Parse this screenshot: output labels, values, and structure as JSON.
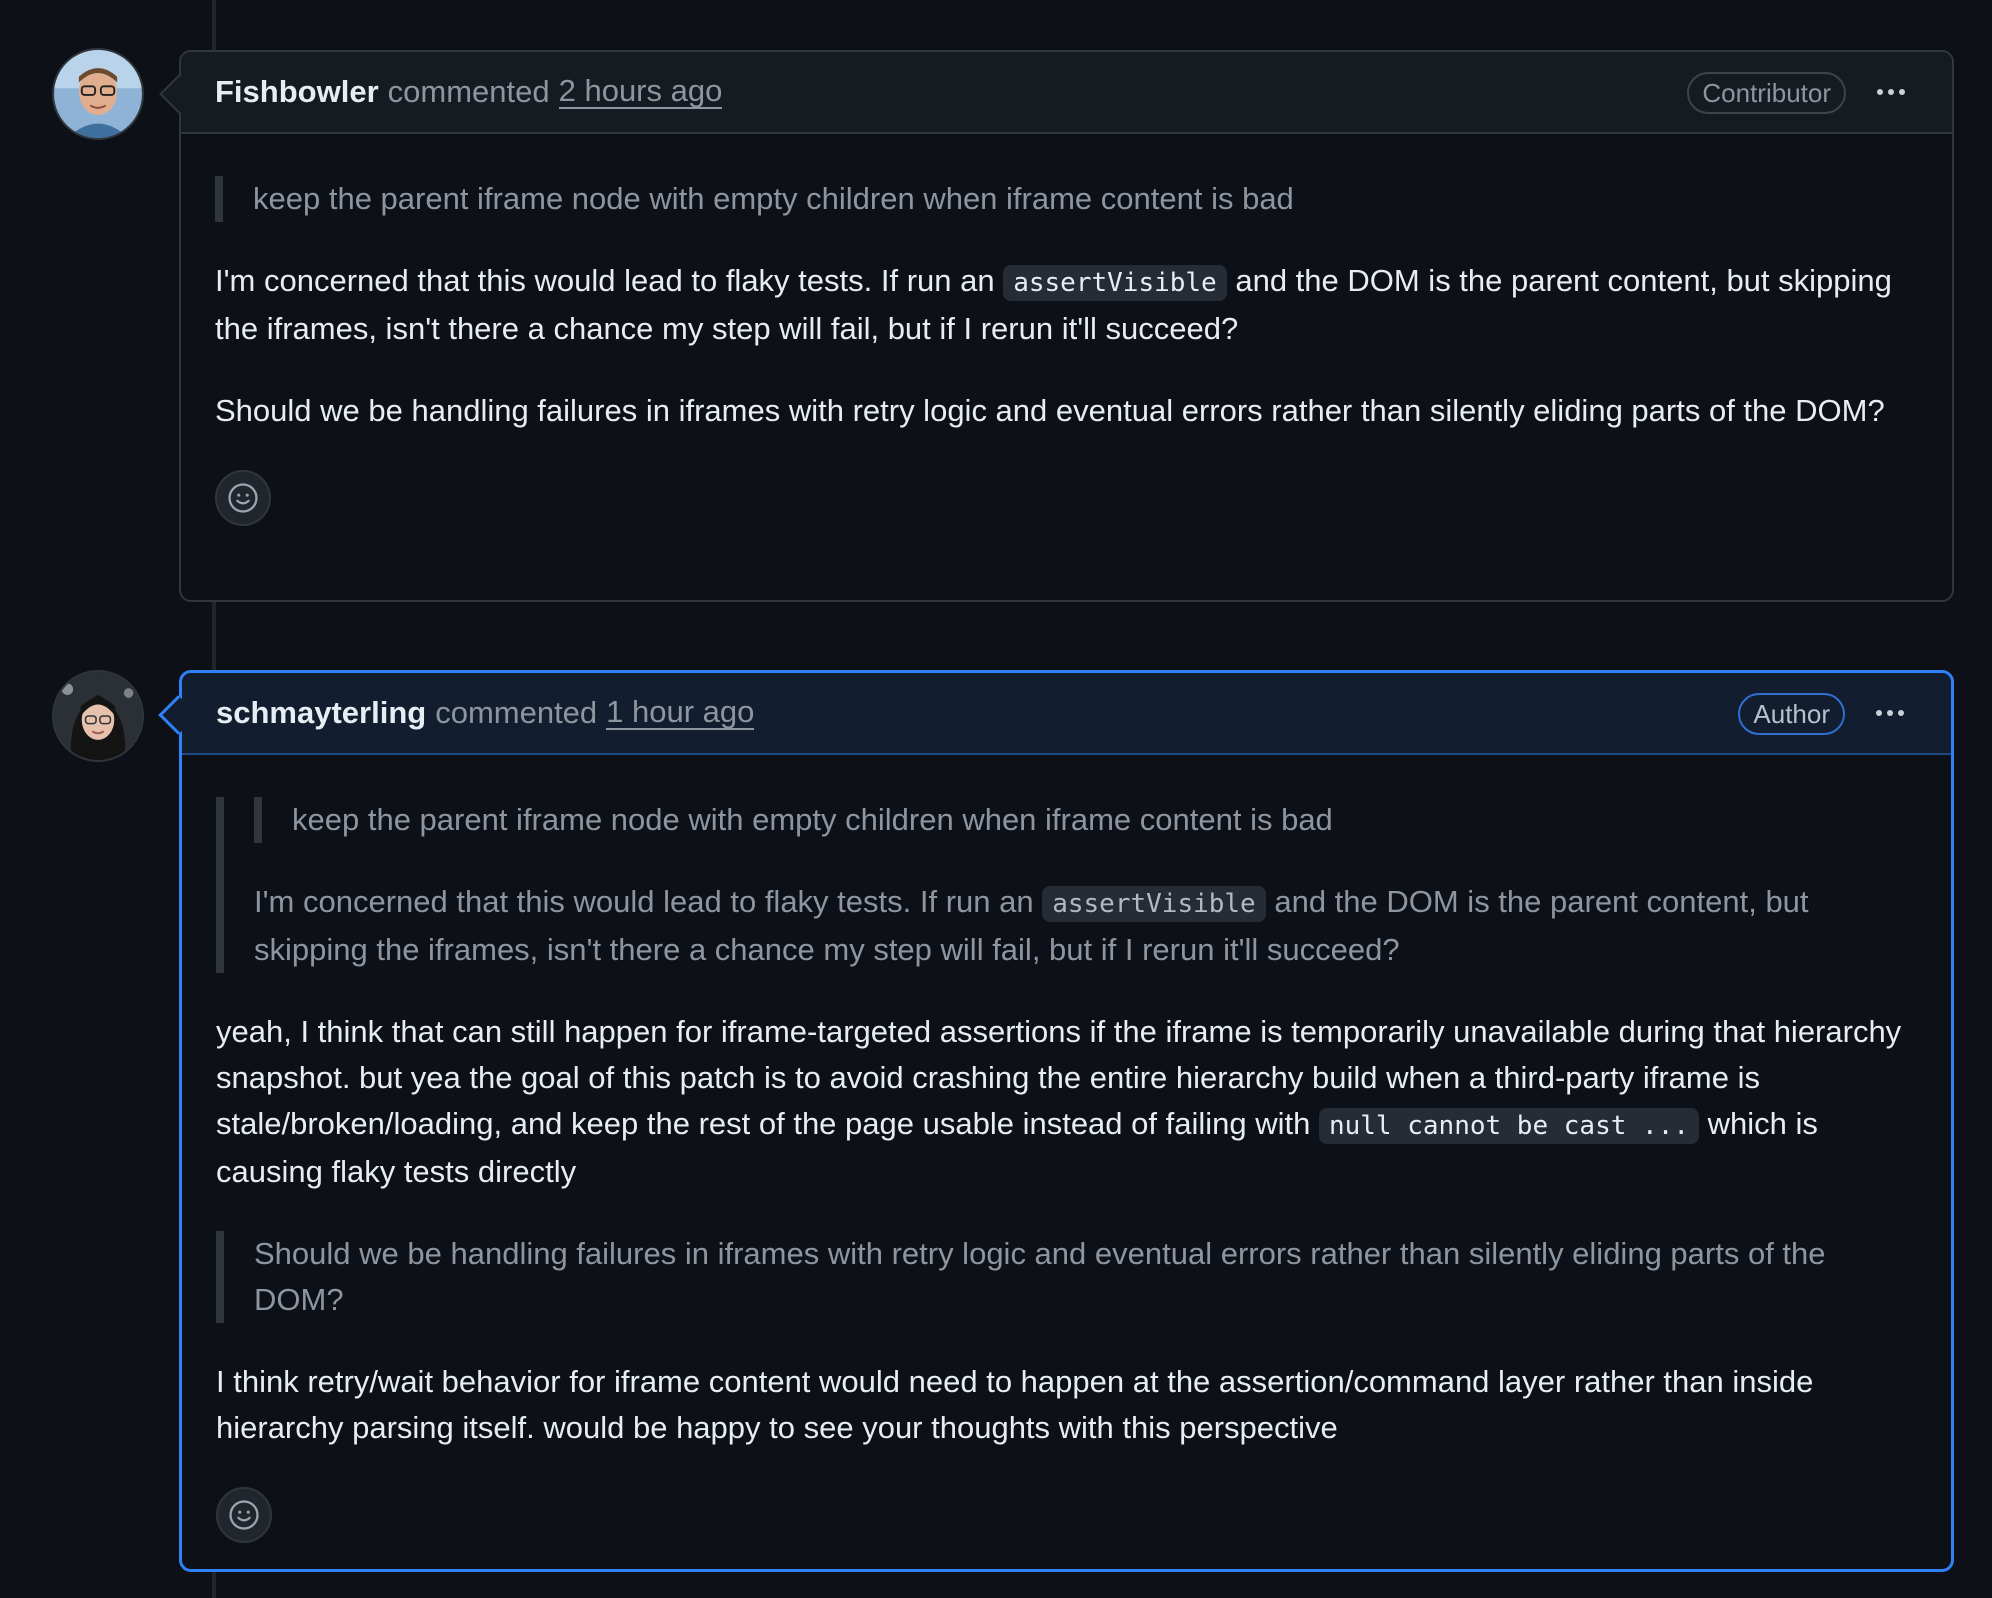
{
  "comments": [
    {
      "username": "Fishbowler",
      "verb": "commented",
      "timestamp": "2 hours ago",
      "role": "Contributor",
      "quote": "keep the parent iframe node with empty children when iframe content is bad",
      "para1_a": "I'm concerned that this would lead to flaky tests. If run an ",
      "para1_code": "assertVisible",
      "para1_b": " and the DOM is the parent content, but skipping the iframes, isn't there a chance my step will fail, but if I rerun it'll succeed?",
      "para2": "Should we be handling failures in iframes with retry logic and eventual errors rather than silently eliding parts of the DOM?"
    },
    {
      "username": "schmayterling",
      "verb": "commented",
      "timestamp": "1 hour ago",
      "role": "Author",
      "nested_quote": "keep the parent iframe node with empty children when iframe content is bad",
      "quote1_a": "I'm concerned that this would lead to flaky tests. If run an ",
      "quote1_code": "assertVisible",
      "quote1_b": " and the DOM is the parent content, but skipping the iframes, isn't there a chance my step will fail, but if I rerun it'll succeed?",
      "para1_a": "yeah, I think that can still happen for iframe-targeted assertions if the iframe is temporarily unavailable during that hierarchy snapshot. but yea the goal of this patch is to avoid crashing the entire hierarchy build when a third-party iframe is stale/broken/loading, and keep the rest of the page usable instead of failing with ",
      "para1_code": "null cannot be cast ...",
      "para1_b": " which is causing flaky tests directly",
      "quote2": "Should we be handling failures in iframes with retry logic and eventual errors rather than silently eliding parts of the DOM?",
      "para2": "I think retry/wait behavior for iframe content would need to happen at the assertion/command layer rather than inside hierarchy parsing itself. would be happy to see your thoughts with this perspective"
    }
  ],
  "icons": {
    "reaction": "smiley-icon",
    "menu": "kebab-horizontal-icon"
  },
  "colors": {
    "background": "#0d1117",
    "author_border": "#2f81f7",
    "muted_text": "#8d96a0"
  }
}
